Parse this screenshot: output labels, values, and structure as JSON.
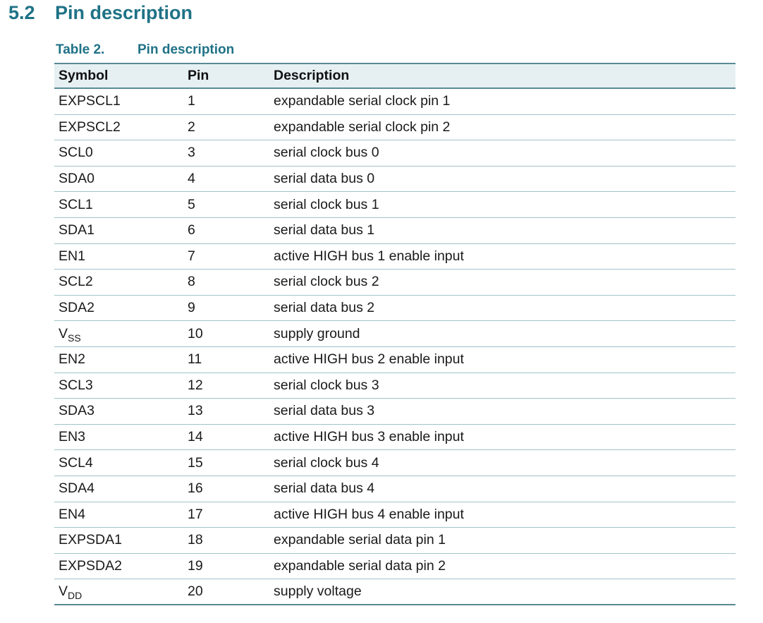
{
  "section": {
    "number": "5.2",
    "title": "Pin description"
  },
  "table": {
    "caption_number": "Table 2.",
    "caption_title": "Pin description",
    "columns": [
      "Symbol",
      "Pin",
      "Description"
    ],
    "rows": [
      {
        "symbol": "EXPSCL1",
        "pin": "1",
        "description": "expandable serial clock pin 1"
      },
      {
        "symbol": "EXPSCL2",
        "pin": "2",
        "description": "expandable serial clock pin 2"
      },
      {
        "symbol": "SCL0",
        "pin": "3",
        "description": "serial clock bus 0"
      },
      {
        "symbol": "SDA0",
        "pin": "4",
        "description": "serial data bus 0"
      },
      {
        "symbol": "SCL1",
        "pin": "5",
        "description": "serial clock bus 1"
      },
      {
        "symbol": "SDA1",
        "pin": "6",
        "description": "serial data bus 1"
      },
      {
        "symbol": "EN1",
        "pin": "7",
        "description": "active HIGH bus 1 enable input"
      },
      {
        "symbol": "SCL2",
        "pin": "8",
        "description": "serial clock bus 2"
      },
      {
        "symbol": "SDA2",
        "pin": "9",
        "description": "serial data bus 2"
      },
      {
        "symbol": "V",
        "symbol_sub": "SS",
        "pin": "10",
        "description": "supply ground"
      },
      {
        "symbol": "EN2",
        "pin": "11",
        "description": "active HIGH bus 2 enable input"
      },
      {
        "symbol": "SCL3",
        "pin": "12",
        "description": "serial clock bus 3"
      },
      {
        "symbol": "SDA3",
        "pin": "13",
        "description": "serial data bus 3"
      },
      {
        "symbol": "EN3",
        "pin": "14",
        "description": "active HIGH bus 3 enable input"
      },
      {
        "symbol": "SCL4",
        "pin": "15",
        "description": "serial clock bus 4"
      },
      {
        "symbol": "SDA4",
        "pin": "16",
        "description": "serial data bus 4"
      },
      {
        "symbol": "EN4",
        "pin": "17",
        "description": "active HIGH bus 4 enable input"
      },
      {
        "symbol": "EXPSDA1",
        "pin": "18",
        "description": "expandable serial data pin 1"
      },
      {
        "symbol": "EXPSDA2",
        "pin": "19",
        "description": "expandable serial data pin 2"
      },
      {
        "symbol": "V",
        "symbol_sub": "DD",
        "pin": "20",
        "description": "supply voltage"
      }
    ]
  },
  "colors": {
    "heading": "#1f7286",
    "header_fill": "#e6f0f2",
    "rule": "#5a8a96",
    "row_divider": "#9fc3cb"
  }
}
